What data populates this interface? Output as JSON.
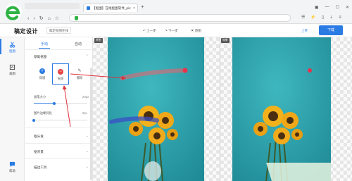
{
  "browser": {
    "tab_title": "【抠图】在线抠图软件_pic抠图在线…",
    "tab_close": "×",
    "new_tab": "+"
  },
  "app": {
    "title": "稿定设计",
    "subtitle": "稿定抠图在线",
    "undo_label": "上一步",
    "redo_label": "下一步",
    "compare_label": "原图",
    "upload_label": "上传",
    "download_label": "下载",
    "accent_color": "#2b7be4"
  },
  "iconbar": {
    "items": [
      {
        "label": "抠图",
        "icon": "scissors-icon"
      },
      {
        "label": "裁图",
        "icon": "crop-icon"
      },
      {
        "label": "帮助",
        "icon": "help-icon"
      }
    ]
  },
  "panel": {
    "tabs": [
      "手动",
      "自动"
    ],
    "section_title": "基础抠图",
    "tools": [
      {
        "label": "保留",
        "symbol": "+",
        "color": "#2b7be4"
      },
      {
        "label": "去除",
        "symbol": "−",
        "color": "#e64545"
      },
      {
        "label": "擦除",
        "symbol": "✎",
        "color": "#555555"
      }
    ],
    "sliders": [
      {
        "label": "画笔大小",
        "value": "20px",
        "fraction": 0.38
      },
      {
        "label": "图片边缘羽化",
        "value": "0px",
        "fraction": 0.0
      }
    ],
    "sections": [
      "抠头发",
      "抠背景",
      "描边工具"
    ]
  },
  "canvas": {
    "left_chip": "原图",
    "right_chip": "效果"
  }
}
